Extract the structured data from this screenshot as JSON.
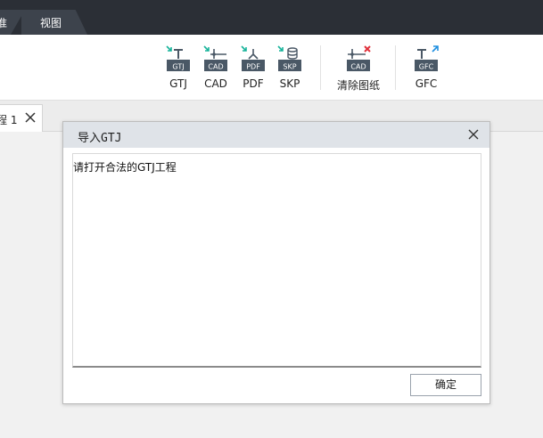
{
  "menubar": {
    "tabs": [
      {
        "label": "准"
      },
      {
        "label": "视图"
      }
    ]
  },
  "ribbon": {
    "buttons": [
      {
        "label": "GTJ",
        "icon_text": "GTJ",
        "icon": "import-gtj-icon"
      },
      {
        "label": "CAD",
        "icon_text": "CAD",
        "icon": "import-cad-icon"
      },
      {
        "label": "PDF",
        "icon_text": "PDF",
        "icon": "import-pdf-icon"
      },
      {
        "label": "SKP",
        "icon_text": "SKP",
        "icon": "import-skp-icon"
      },
      {
        "label": "清除图纸",
        "icon_text": "CAD",
        "icon": "clear-drawing-icon"
      },
      {
        "label": "GFC",
        "icon_text": "GFC",
        "icon": "export-gfc-icon"
      }
    ],
    "colors": {
      "icon_fill": "#4a5866",
      "arrow_green": "#17b39a",
      "cross_red": "#e0303a",
      "arrow_blue": "#1f8fe0"
    }
  },
  "doc_tab": {
    "label": "程 1"
  },
  "dialog": {
    "title": "导入GTJ",
    "message": "请打开合法的GTJ工程",
    "ok_label": "确定"
  }
}
